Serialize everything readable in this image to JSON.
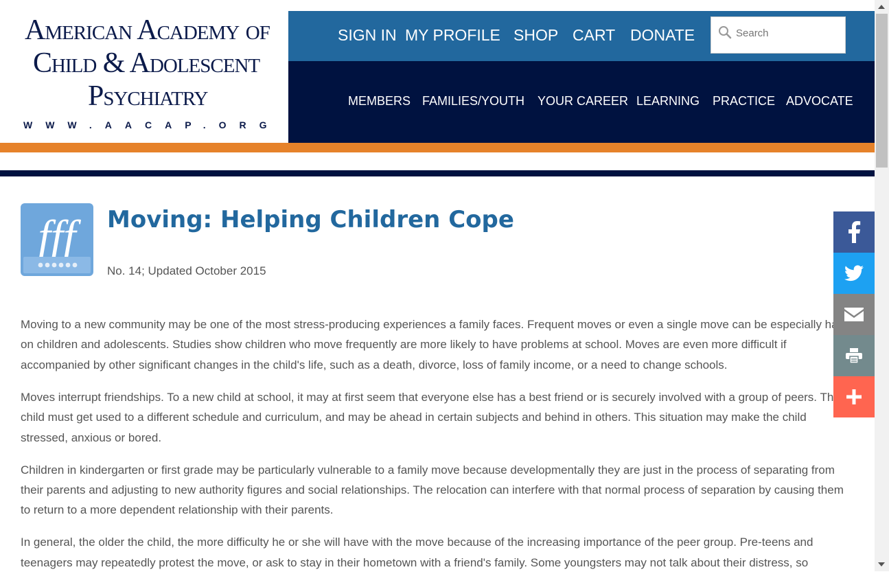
{
  "logo": {
    "line1": "American Academy of",
    "line2": "Child & Adolescent",
    "line3": "Psychiatry",
    "url": "WWW.AACAP.ORG"
  },
  "top_nav": [
    "SIGN IN",
    "MY PROFILE",
    "SHOP",
    "CART",
    "DONATE"
  ],
  "search": {
    "placeholder": "Search",
    "value": ""
  },
  "main_nav": [
    "MEMBERS",
    "FAMILIES/YOUTH",
    "YOUR CAREER",
    "LEARNING",
    "PRACTICE",
    "ADVOCATE"
  ],
  "article": {
    "title": "Moving: Helping Children Cope",
    "subtitle": "No. 14; Updated October 2015",
    "paragraphs": [
      "Moving to a new community may be one of the most stress-producing experiences a family faces. Frequent moves or even a single move can be especially hard on children and adolescents. Studies show children who move frequently are more likely to have problems at school. Moves are even more difficult if accompanied by other significant changes in the child's life, such as a death, divorce, loss of family income, or a need to change schools.",
      "Moves interrupt friendships. To a new child at school, it may at first seem that everyone else has a best friend or is securely involved with a group of peers. The child must get used to a different schedule and curriculum, and may be ahead in certain subjects and behind in others. This situation may make the child stressed, anxious or bored.",
      "Children in kindergarten or first grade may be particularly vulnerable to a family move because developmentally they are just in the process of separating from their parents and adjusting to new authority figures and social relationships. The relocation can interfere with that normal process of separation by causing them to return to a more dependent relationship with their parents.",
      "In general, the older the child, the more difficulty he or she will have with the move because of the increasing importance of the peer group. Pre-teens and teenagers may repeatedly protest the move, or ask to stay in their hometown with a friend's family. Some youngsters may not talk about their distress, so"
    ]
  },
  "share": [
    {
      "name": "facebook-icon",
      "color": "#3b5998"
    },
    {
      "name": "twitter-icon",
      "color": "#1da1f2"
    },
    {
      "name": "email-icon",
      "color": "#848484"
    },
    {
      "name": "print-icon",
      "color": "#738a8d"
    },
    {
      "name": "plus-icon",
      "color": "#ff6550"
    }
  ],
  "colors": {
    "top_bar": "#22689e",
    "main_nav": "#001240",
    "orange_stripe": "#e6822a",
    "title": "#22689e",
    "fff_logo": "#6fa7dc"
  }
}
